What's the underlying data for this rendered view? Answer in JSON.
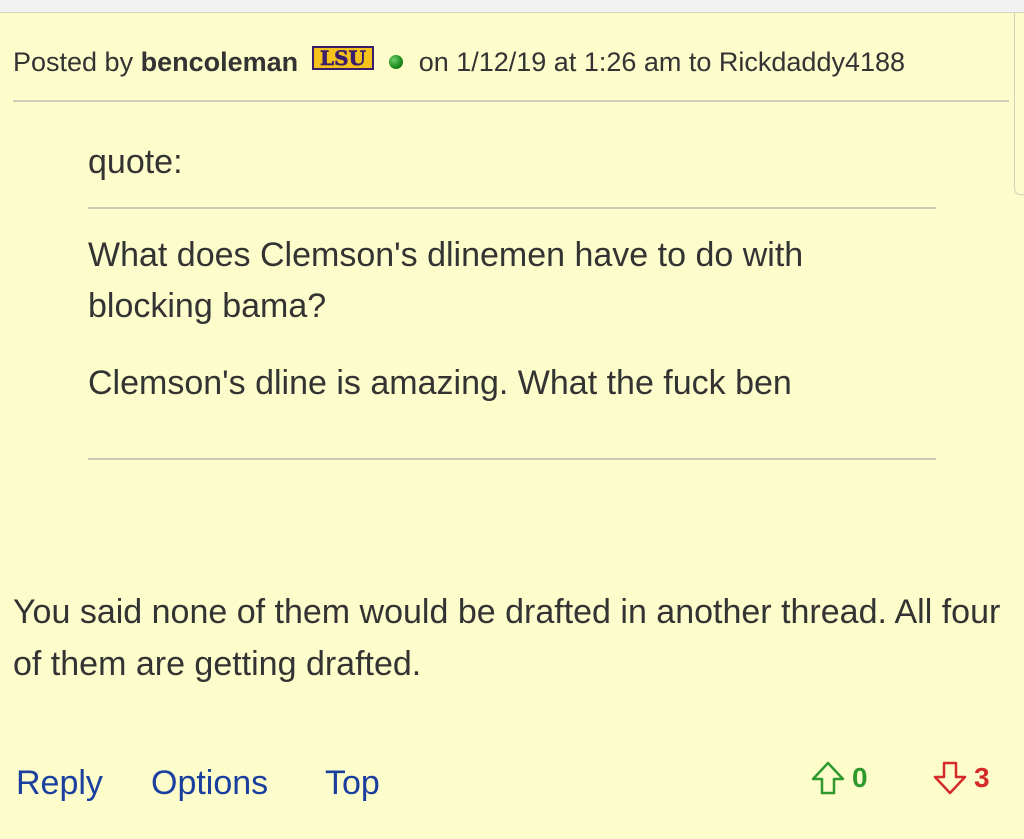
{
  "post": {
    "posted_by_label": "Posted by",
    "author": "bencoleman",
    "team_logo_text": "LSU",
    "meta": "on 1/12/19 at 1:26 am to Rickdaddy4188"
  },
  "quote": {
    "label": "quote:",
    "paragraphs": [
      "What does Clemson's dlinemen have to do with blocking bama?",
      "Clemson's dline is amazing. What the fuck ben"
    ]
  },
  "body": "You said none of them would be drafted in another thread. All four of them are getting drafted.",
  "footer": {
    "reply_label": "Reply",
    "options_label": "Options",
    "top_label": "Top",
    "upvote_count": "0",
    "downvote_count": "3"
  },
  "colors": {
    "background": "#fdfccb",
    "link": "#1a3f9e",
    "upvote": "#2e9a2e",
    "downvote": "#d42a2a",
    "lsu_purple": "#3b1e6b",
    "lsu_gold": "#f5c21b"
  },
  "icons": {
    "team": "lsu-logo-icon",
    "status": "online-status-icon",
    "upvote": "arrow-up-icon",
    "downvote": "arrow-down-icon"
  }
}
